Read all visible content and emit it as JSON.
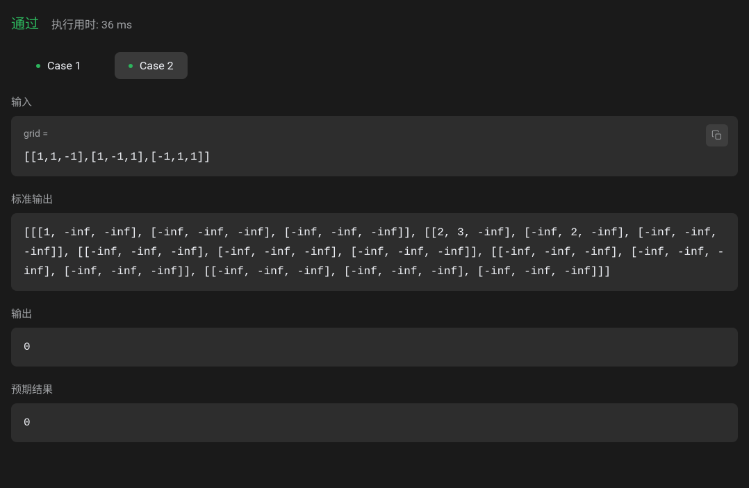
{
  "header": {
    "status": "通过",
    "runtime_prefix": "执行用时: ",
    "runtime_value": "36 ms"
  },
  "tabs": [
    {
      "label": "Case 1",
      "active": false
    },
    {
      "label": "Case 2",
      "active": true
    }
  ],
  "sections": {
    "input": {
      "label": "输入",
      "param_label": "grid =",
      "value": "[[1,1,-1],[1,-1,1],[-1,1,1]]"
    },
    "stdout": {
      "label": "标准输出",
      "value": "[[[1, -inf, -inf], [-inf, -inf, -inf], [-inf, -inf, -inf]], [[2, 3, -inf], [-inf, 2, -inf], [-inf, -inf, -inf]], [[-inf, -inf, -inf], [-inf, -inf, -inf], [-inf, -inf, -inf]], [[-inf, -inf, -inf], [-inf, -inf, -inf], [-inf, -inf, -inf]], [[-inf, -inf, -inf], [-inf, -inf, -inf], [-inf, -inf, -inf]]]"
    },
    "output": {
      "label": "输出",
      "value": "0"
    },
    "expected": {
      "label": "预期结果",
      "value": "0"
    }
  }
}
